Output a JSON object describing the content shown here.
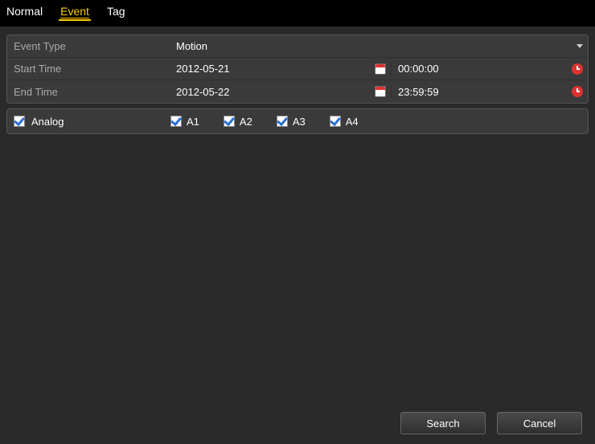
{
  "tabs": {
    "normal": "Normal",
    "event": "Event",
    "tag": "Tag",
    "active": "event"
  },
  "form": {
    "eventType": {
      "label": "Event Type",
      "value": "Motion"
    },
    "startTime": {
      "label": "Start Time",
      "date": "2012-05-21",
      "time": "00:00:00"
    },
    "endTime": {
      "label": "End Time",
      "date": "2012-05-22",
      "time": "23:59:59"
    }
  },
  "channels": {
    "groupLabel": "Analog",
    "groupChecked": true,
    "items": [
      {
        "label": "A1",
        "checked": true
      },
      {
        "label": "A2",
        "checked": true
      },
      {
        "label": "A3",
        "checked": true
      },
      {
        "label": "A4",
        "checked": true
      }
    ]
  },
  "buttons": {
    "search": "Search",
    "cancel": "Cancel"
  }
}
